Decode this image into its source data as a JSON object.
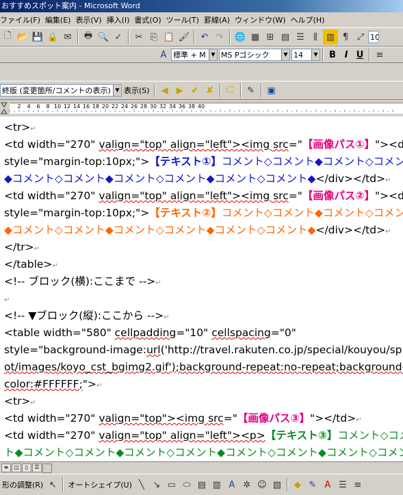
{
  "window": {
    "title": "おすすめスポット案内 - Microsoft Word"
  },
  "menu": {
    "items": [
      "ファイル(F)",
      "編集(E)",
      "表示(V)",
      "挿入(I)",
      "書式(O)",
      "ツール(T)",
      "罫線(A)",
      "ウィンドウ(W)",
      "ヘルプ(H)"
    ]
  },
  "formatting": {
    "style": "標準 + M",
    "font": "MS Pゴシック",
    "size": "14",
    "bold": "B",
    "italic": "I",
    "underline": "U",
    "zoom_partial": "10"
  },
  "reviewing": {
    "display_mode": "終版 (変更箇所/コメントの表示)",
    "show_label": "表示(S)"
  },
  "ruler": {
    "ticks": [
      "2",
      "4",
      "6",
      "8",
      "10",
      "12",
      "14",
      "16",
      "18",
      "20",
      "22",
      "24",
      "26",
      "28",
      "30",
      "32",
      "34",
      "36",
      "38",
      "40"
    ]
  },
  "document": {
    "l1": "<tr>",
    "l2a": "<td width=\"270\"  ",
    "l2b": "valign=\"top\" align=\"left\"><img ",
    "l2c": "src",
    "l2d": "=\"",
    "l2e": "【画像パス①】",
    "l2f": "\"><div",
    "l3a": "style=\"margin-top:10px;\">",
    "l3b": "【テキスト①】",
    "l3c": "コメント◇コメント◆コメント◇コメント",
    "l4a": "◆コメント◇コメント◆コメント◇コメント◆コメント◇コメント◆",
    "l4b": "</div></td>",
    "l5a": "<td width=\"270\"  ",
    "l5b": "valign=\"top\" align=\"left\"><img ",
    "l5c": "src",
    "l5d": "=\"",
    "l5e": "【画像パス②】",
    "l5f": "\"><div",
    "l6a": "style=\"margin-top:10px;\">",
    "l6b": "【テキスト②】",
    "l6c": "コメント◇コメント◆コメント◇コメント",
    "l7a": "◆コメント◇コメント◆コメント◇コメント◆コメント◇コメント◆",
    "l7b": "</div></td>",
    "l8": "</tr>",
    "l9": "</table>",
    "l10": "<!-- ブロック(横):ここまで -->",
    "l11": "",
    "l12": "<!-- ▼ブロック(縦):ここから -->",
    "l13a": "<table width=\"580\" ",
    "l13b": "cellpadding",
    "l13c": "=\"10\" ",
    "l13d": "cellspacing",
    "l13e": "=\"0\"",
    "l14a": "style=\"background-image:",
    "l14b": "url",
    "l14c": "('http://travel.rakuten.co.jp/special/kouyou/sp",
    "l15a": "ot/images/koyo_cst_bgimg2.gif');background-repeat:no-repeat;background-",
    "l16a": "color:#FFFFFF;",
    "l16b": "\">",
    "l17": "<tr>",
    "l18a": "<td width=\"270\"  ",
    "l18b": "valign=\"top\"><img ",
    "l18c": "src",
    "l18d": "=\"",
    "l18e": "【画像パス③】",
    "l18f": "\"></td>",
    "l19a": "<td width=\"270\"  ",
    "l19b": "valign=\"top\" align=\"left\"><p>",
    "l19c": "【テキスト③】",
    "l19d": "コメント◇コメント",
    "l20a": "ト◆コメント◇コメント◆コメント◇コメント◆コメント◇コメント◆コメント◇コメント"
  },
  "drawing": {
    "adjust": "形の調整(R)",
    "autoshape": "オートシェイプ(U)"
  },
  "colors": {
    "magenta": "#e6007e",
    "blue": "#1515c8",
    "orange": "#ff6600",
    "green": "#0b8a22"
  }
}
